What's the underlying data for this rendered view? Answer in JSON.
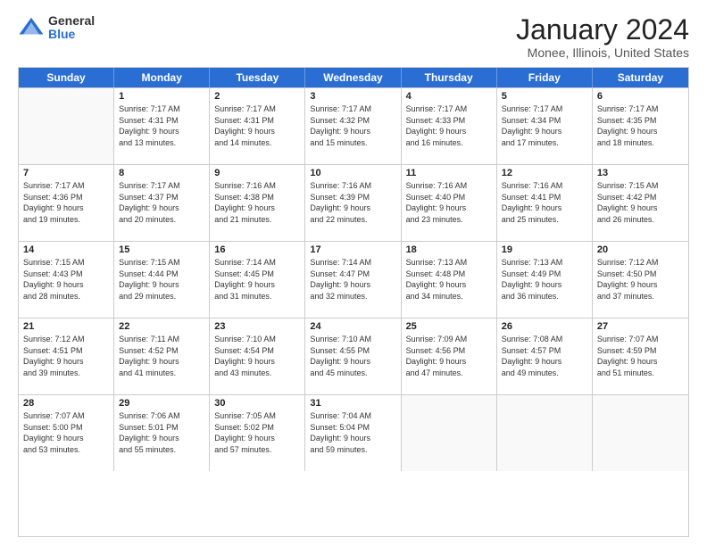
{
  "logo": {
    "general": "General",
    "blue": "Blue"
  },
  "title": "January 2024",
  "location": "Monee, Illinois, United States",
  "days": [
    "Sunday",
    "Monday",
    "Tuesday",
    "Wednesday",
    "Thursday",
    "Friday",
    "Saturday"
  ],
  "weeks": [
    [
      {
        "day": "",
        "info": ""
      },
      {
        "day": "1",
        "info": "Sunrise: 7:17 AM\nSunset: 4:31 PM\nDaylight: 9 hours\nand 13 minutes."
      },
      {
        "day": "2",
        "info": "Sunrise: 7:17 AM\nSunset: 4:31 PM\nDaylight: 9 hours\nand 14 minutes."
      },
      {
        "day": "3",
        "info": "Sunrise: 7:17 AM\nSunset: 4:32 PM\nDaylight: 9 hours\nand 15 minutes."
      },
      {
        "day": "4",
        "info": "Sunrise: 7:17 AM\nSunset: 4:33 PM\nDaylight: 9 hours\nand 16 minutes."
      },
      {
        "day": "5",
        "info": "Sunrise: 7:17 AM\nSunset: 4:34 PM\nDaylight: 9 hours\nand 17 minutes."
      },
      {
        "day": "6",
        "info": "Sunrise: 7:17 AM\nSunset: 4:35 PM\nDaylight: 9 hours\nand 18 minutes."
      }
    ],
    [
      {
        "day": "7",
        "info": "Sunrise: 7:17 AM\nSunset: 4:36 PM\nDaylight: 9 hours\nand 19 minutes."
      },
      {
        "day": "8",
        "info": "Sunrise: 7:17 AM\nSunset: 4:37 PM\nDaylight: 9 hours\nand 20 minutes."
      },
      {
        "day": "9",
        "info": "Sunrise: 7:16 AM\nSunset: 4:38 PM\nDaylight: 9 hours\nand 21 minutes."
      },
      {
        "day": "10",
        "info": "Sunrise: 7:16 AM\nSunset: 4:39 PM\nDaylight: 9 hours\nand 22 minutes."
      },
      {
        "day": "11",
        "info": "Sunrise: 7:16 AM\nSunset: 4:40 PM\nDaylight: 9 hours\nand 23 minutes."
      },
      {
        "day": "12",
        "info": "Sunrise: 7:16 AM\nSunset: 4:41 PM\nDaylight: 9 hours\nand 25 minutes."
      },
      {
        "day": "13",
        "info": "Sunrise: 7:15 AM\nSunset: 4:42 PM\nDaylight: 9 hours\nand 26 minutes."
      }
    ],
    [
      {
        "day": "14",
        "info": "Sunrise: 7:15 AM\nSunset: 4:43 PM\nDaylight: 9 hours\nand 28 minutes."
      },
      {
        "day": "15",
        "info": "Sunrise: 7:15 AM\nSunset: 4:44 PM\nDaylight: 9 hours\nand 29 minutes."
      },
      {
        "day": "16",
        "info": "Sunrise: 7:14 AM\nSunset: 4:45 PM\nDaylight: 9 hours\nand 31 minutes."
      },
      {
        "day": "17",
        "info": "Sunrise: 7:14 AM\nSunset: 4:47 PM\nDaylight: 9 hours\nand 32 minutes."
      },
      {
        "day": "18",
        "info": "Sunrise: 7:13 AM\nSunset: 4:48 PM\nDaylight: 9 hours\nand 34 minutes."
      },
      {
        "day": "19",
        "info": "Sunrise: 7:13 AM\nSunset: 4:49 PM\nDaylight: 9 hours\nand 36 minutes."
      },
      {
        "day": "20",
        "info": "Sunrise: 7:12 AM\nSunset: 4:50 PM\nDaylight: 9 hours\nand 37 minutes."
      }
    ],
    [
      {
        "day": "21",
        "info": "Sunrise: 7:12 AM\nSunset: 4:51 PM\nDaylight: 9 hours\nand 39 minutes."
      },
      {
        "day": "22",
        "info": "Sunrise: 7:11 AM\nSunset: 4:52 PM\nDaylight: 9 hours\nand 41 minutes."
      },
      {
        "day": "23",
        "info": "Sunrise: 7:10 AM\nSunset: 4:54 PM\nDaylight: 9 hours\nand 43 minutes."
      },
      {
        "day": "24",
        "info": "Sunrise: 7:10 AM\nSunset: 4:55 PM\nDaylight: 9 hours\nand 45 minutes."
      },
      {
        "day": "25",
        "info": "Sunrise: 7:09 AM\nSunset: 4:56 PM\nDaylight: 9 hours\nand 47 minutes."
      },
      {
        "day": "26",
        "info": "Sunrise: 7:08 AM\nSunset: 4:57 PM\nDaylight: 9 hours\nand 49 minutes."
      },
      {
        "day": "27",
        "info": "Sunrise: 7:07 AM\nSunset: 4:59 PM\nDaylight: 9 hours\nand 51 minutes."
      }
    ],
    [
      {
        "day": "28",
        "info": "Sunrise: 7:07 AM\nSunset: 5:00 PM\nDaylight: 9 hours\nand 53 minutes."
      },
      {
        "day": "29",
        "info": "Sunrise: 7:06 AM\nSunset: 5:01 PM\nDaylight: 9 hours\nand 55 minutes."
      },
      {
        "day": "30",
        "info": "Sunrise: 7:05 AM\nSunset: 5:02 PM\nDaylight: 9 hours\nand 57 minutes."
      },
      {
        "day": "31",
        "info": "Sunrise: 7:04 AM\nSunset: 5:04 PM\nDaylight: 9 hours\nand 59 minutes."
      },
      {
        "day": "",
        "info": ""
      },
      {
        "day": "",
        "info": ""
      },
      {
        "day": "",
        "info": ""
      }
    ]
  ]
}
